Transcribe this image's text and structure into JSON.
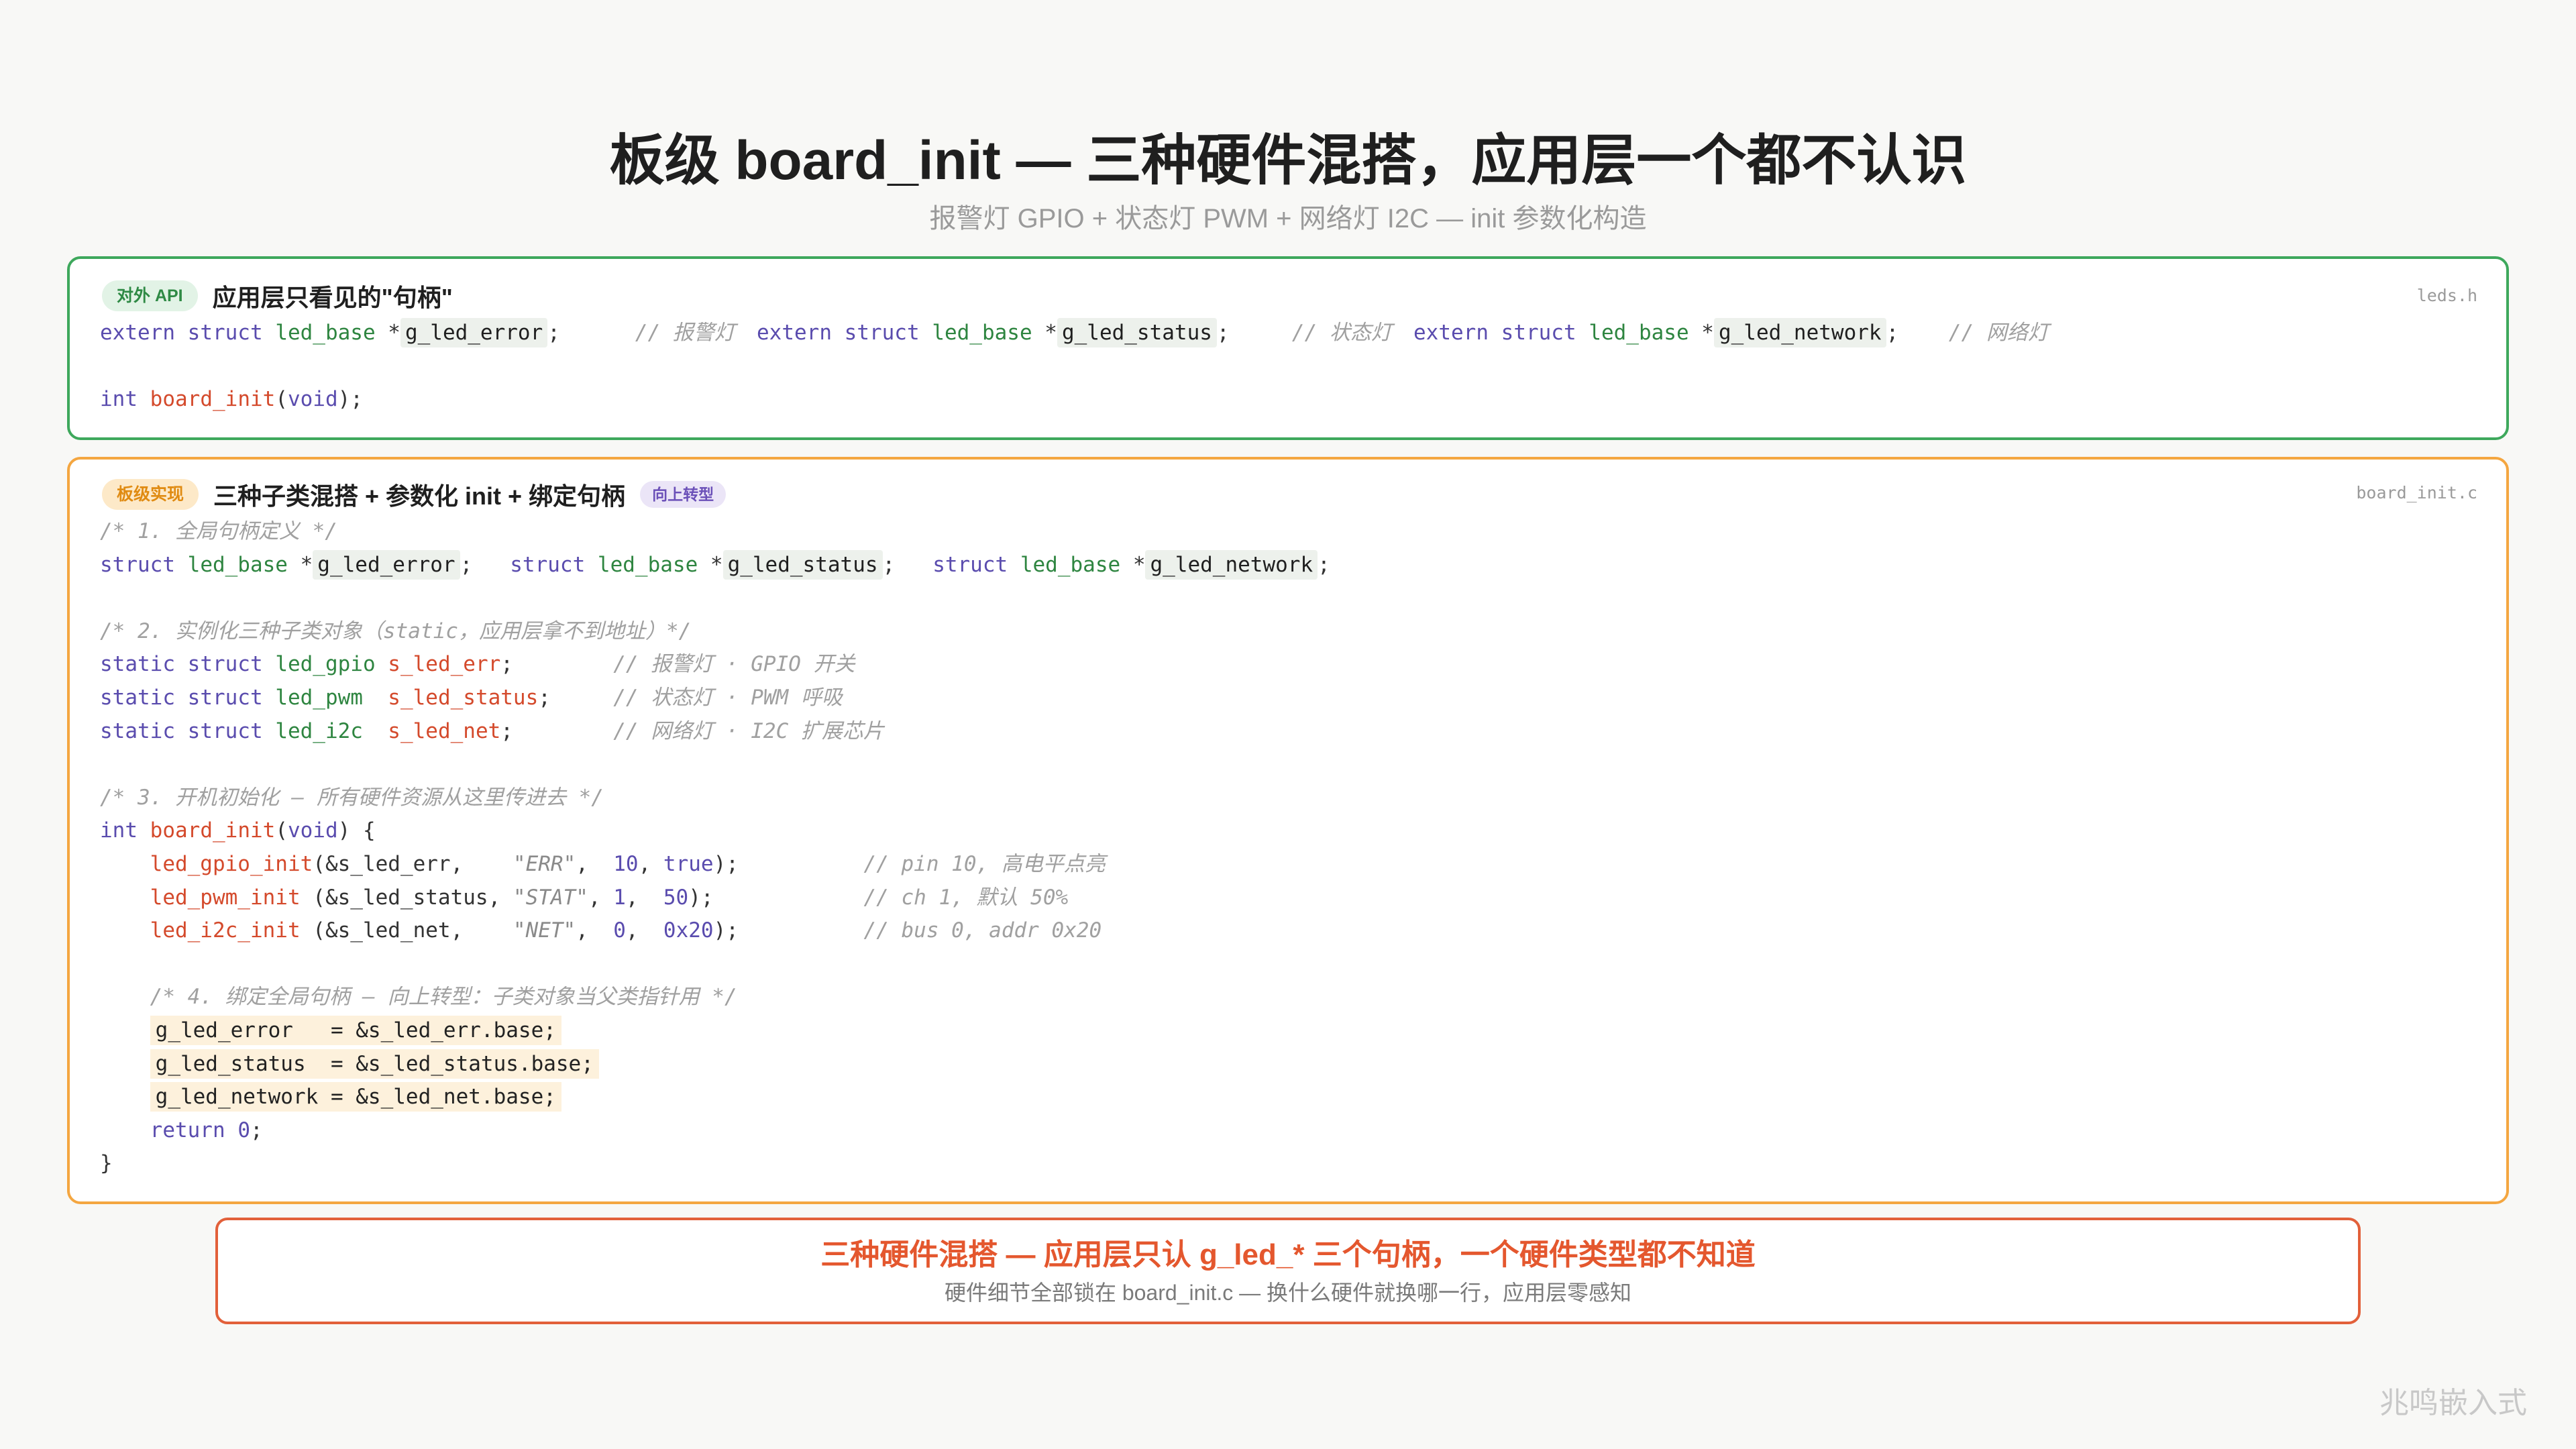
{
  "page": {
    "title": "板级 board_init — 三种硬件混搭，应用层一个都不认识",
    "subtitle": "报警灯 GPIO + 状态灯 PWM + 网络灯 I2C — init 参数化构造"
  },
  "api": {
    "badge": "对外 API",
    "title": "应用层只看见的\"句柄\"",
    "file": "leds.h",
    "decls": [
      [
        {
          "kw": "extern"
        },
        {
          "t": " "
        },
        {
          "kw": "struct"
        },
        {
          "t": " "
        },
        {
          "type": "led_base"
        },
        {
          "t": " *"
        },
        {
          "hl": "g_led_error"
        },
        {
          "t": ";      "
        },
        {
          "cm": "// 报警灯"
        }
      ],
      [
        {
          "kw": "extern"
        },
        {
          "t": " "
        },
        {
          "kw": "struct"
        },
        {
          "t": " "
        },
        {
          "type": "led_base"
        },
        {
          "t": " *"
        },
        {
          "hl": "g_led_status"
        },
        {
          "t": ";     "
        },
        {
          "cm": "// 状态灯"
        }
      ],
      [
        {
          "kw": "extern"
        },
        {
          "t": " "
        },
        {
          "kw": "struct"
        },
        {
          "t": " "
        },
        {
          "type": "led_base"
        },
        {
          "t": " *"
        },
        {
          "hl": "g_led_network"
        },
        {
          "t": ";    "
        },
        {
          "cm": "// 网络灯"
        }
      ]
    ],
    "code": [
      [],
      [
        {
          "kw": "int"
        },
        {
          "t": " "
        },
        {
          "fn": "board_init"
        },
        {
          "t": "("
        },
        {
          "kw": "void"
        },
        {
          "t": ");"
        }
      ]
    ]
  },
  "impl": {
    "badge": "板级实现",
    "title": "三种子类混搭 + 参数化 init + 绑定句柄",
    "tag": "向上转型",
    "file": "board_init.c",
    "code": [
      [
        {
          "cm": "/* 1. 全局句柄定义 */"
        }
      ],
      [
        {
          "kw": "struct"
        },
        {
          "t": " "
        },
        {
          "type": "led_base"
        },
        {
          "t": " *"
        },
        {
          "hl": "g_led_error"
        },
        {
          "t": ";   "
        },
        {
          "kw": "struct"
        },
        {
          "t": " "
        },
        {
          "type": "led_base"
        },
        {
          "t": " *"
        },
        {
          "hl": "g_led_status"
        },
        {
          "t": ";   "
        },
        {
          "kw": "struct"
        },
        {
          "t": " "
        },
        {
          "type": "led_base"
        },
        {
          "t": " *"
        },
        {
          "hl": "g_led_network"
        },
        {
          "t": ";"
        }
      ],
      [],
      [
        {
          "cm": "/* 2. 实例化三种子类对象（static，应用层拿不到地址）*/"
        }
      ],
      [
        {
          "kw": "static"
        },
        {
          "t": " "
        },
        {
          "kw": "struct"
        },
        {
          "t": " "
        },
        {
          "type": "led_gpio"
        },
        {
          "t": " "
        },
        {
          "var": "s_led_err"
        },
        {
          "t": ";        "
        },
        {
          "cm": "// 报警灯 · GPIO 开关"
        }
      ],
      [
        {
          "kw": "static"
        },
        {
          "t": " "
        },
        {
          "kw": "struct"
        },
        {
          "t": " "
        },
        {
          "type": "led_pwm"
        },
        {
          "t": "  "
        },
        {
          "var": "s_led_status"
        },
        {
          "t": ";     "
        },
        {
          "cm": "// 状态灯 · PWM 呼吸"
        }
      ],
      [
        {
          "kw": "static"
        },
        {
          "t": " "
        },
        {
          "kw": "struct"
        },
        {
          "t": " "
        },
        {
          "type": "led_i2c"
        },
        {
          "t": "  "
        },
        {
          "var": "s_led_net"
        },
        {
          "t": ";        "
        },
        {
          "cm": "// 网络灯 · I2C 扩展芯片"
        }
      ],
      [],
      [
        {
          "cm": "/* 3. 开机初始化 — 所有硬件资源从这里传进去 */"
        }
      ],
      [
        {
          "kw": "int"
        },
        {
          "t": " "
        },
        {
          "fn": "board_init"
        },
        {
          "t": "("
        },
        {
          "kw": "void"
        },
        {
          "t": ") {"
        }
      ],
      [
        {
          "t": "    "
        },
        {
          "fn": "led_gpio_init"
        },
        {
          "t": "(&s_led_err,    "
        },
        {
          "str": "\"ERR\""
        },
        {
          "t": ",  "
        },
        {
          "num": "10"
        },
        {
          "t": ", "
        },
        {
          "kw": "true"
        },
        {
          "t": ");          "
        },
        {
          "cm": "// pin 10, 高电平点亮"
        }
      ],
      [
        {
          "t": "    "
        },
        {
          "fn": "led_pwm_init"
        },
        {
          "t": " (&s_led_status, "
        },
        {
          "str": "\"STAT\""
        },
        {
          "t": ", "
        },
        {
          "num": "1"
        },
        {
          "t": ",  "
        },
        {
          "num": "50"
        },
        {
          "t": ");            "
        },
        {
          "cm": "// ch 1, 默认 50%"
        }
      ],
      [
        {
          "t": "    "
        },
        {
          "fn": "led_i2c_init"
        },
        {
          "t": " (&s_led_net,    "
        },
        {
          "str": "\"NET\""
        },
        {
          "t": ",  "
        },
        {
          "num": "0"
        },
        {
          "t": ",  "
        },
        {
          "num": "0x20"
        },
        {
          "t": ");          "
        },
        {
          "cm": "// bus 0, addr 0x20"
        }
      ],
      [],
      [
        {
          "t": "    "
        },
        {
          "cm": "/* 4. 绑定全局句柄 — 向上转型：子类对象当父类指针用 */"
        }
      ],
      [
        {
          "t": "    "
        },
        {
          "hll": "g_led_error   = &s_led_err.base;"
        }
      ],
      [
        {
          "t": "    "
        },
        {
          "hll": "g_led_status  = &s_led_status.base;"
        }
      ],
      [
        {
          "t": "    "
        },
        {
          "hll": "g_led_network = &s_led_net.base;"
        }
      ],
      [
        {
          "t": "    "
        },
        {
          "kw": "return"
        },
        {
          "t": " "
        },
        {
          "num": "0"
        },
        {
          "t": ";"
        }
      ],
      [
        {
          "t": "}"
        }
      ]
    ]
  },
  "summary": {
    "headline": "三种硬件混搭 — 应用层只认 g_led_* 三个句柄，一个硬件类型都不知道",
    "detail": "硬件细节全部锁在 board_init.c — 换什么硬件就换哪一行，应用层零感知"
  },
  "watermark": "兆鸣嵌入式",
  "colors": {
    "api_accent": "#3ea85c",
    "impl_accent": "#f4a640",
    "cast_tag": "#6b50b8",
    "summary_accent": "#e2603a",
    "background": "#f8f8f6"
  }
}
